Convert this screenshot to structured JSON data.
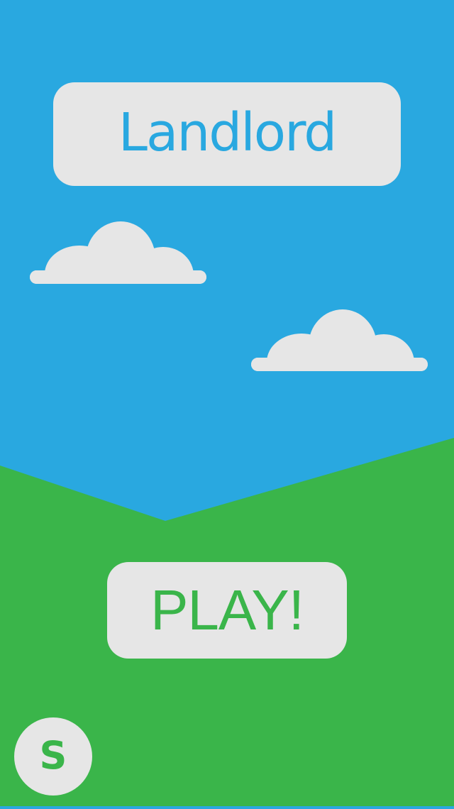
{
  "app": {
    "title": "Landlord"
  },
  "menu": {
    "play_label": "PLAY!",
    "settings_label": "S"
  },
  "colors": {
    "sky": "#29A8E0",
    "grass": "#3AB54A",
    "panel": "#E6E6E6",
    "cloud": "#E6E6E6"
  },
  "icons": {
    "cloud_left": "cloud-icon",
    "cloud_right": "cloud-icon"
  }
}
